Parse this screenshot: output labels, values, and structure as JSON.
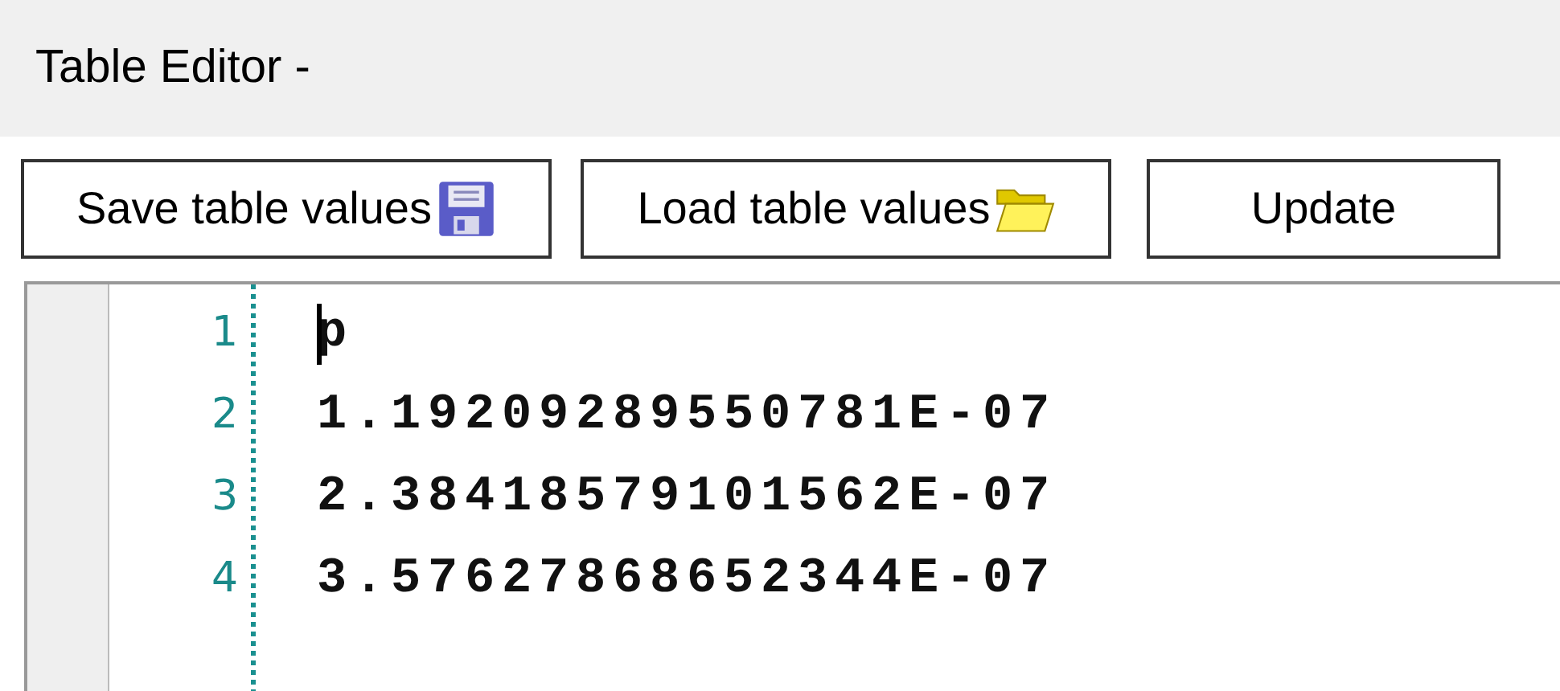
{
  "window": {
    "title": "Table Editor -"
  },
  "toolbar": {
    "buttons": [
      {
        "label": "Save table values",
        "kind": "save"
      },
      {
        "label": "Load table values",
        "kind": "load"
      },
      {
        "label": "Update",
        "kind": "plain"
      }
    ]
  },
  "editor": {
    "lines": [
      {
        "number": "1",
        "text": "p"
      },
      {
        "number": "2",
        "text": "1.19209289550781E-07"
      },
      {
        "number": "3",
        "text": "2.38418579101562E-07"
      },
      {
        "number": "4",
        "text": "3.57627868652344E-07"
      }
    ]
  }
}
